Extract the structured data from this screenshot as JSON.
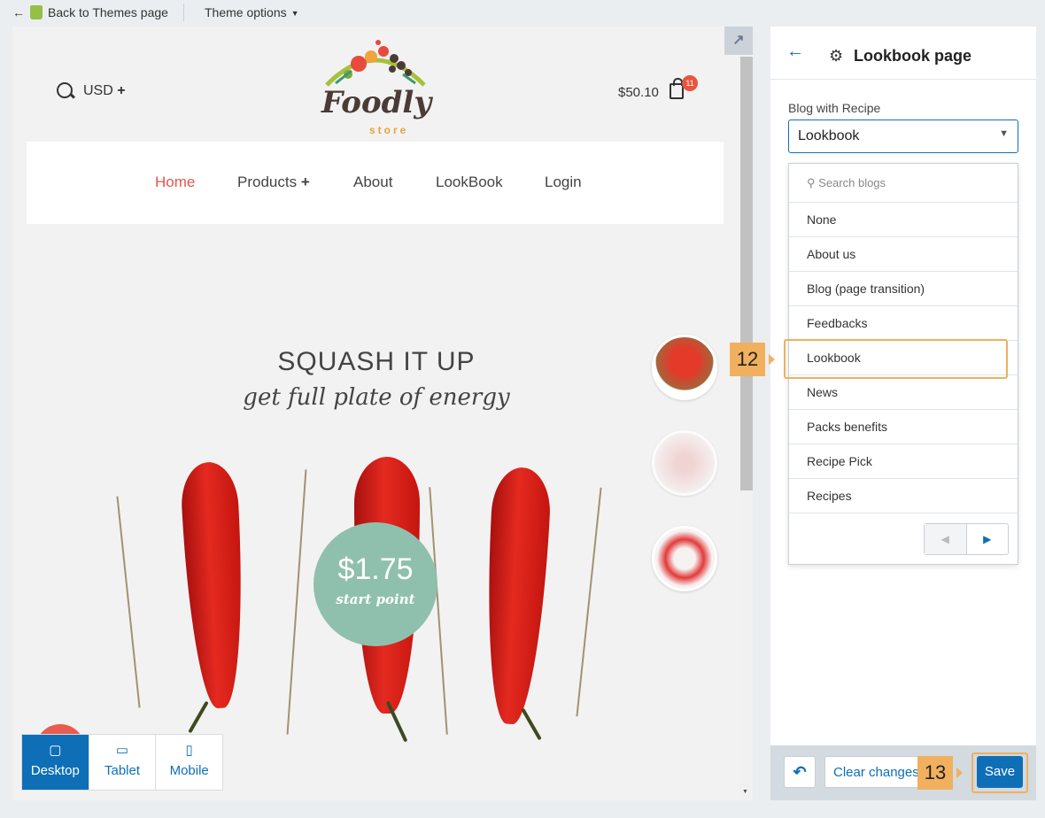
{
  "topbar": {
    "back_label": "Back to Themes page",
    "theme_options_label": "Theme options"
  },
  "store": {
    "currency": "USD",
    "logo_word": "Foodly",
    "logo_sub": "store",
    "cart_total": "$50.10",
    "cart_count": "11",
    "nav": [
      "Home",
      "Products",
      "About",
      "LookBook",
      "Login"
    ],
    "hero_title": "SQUASH IT UP",
    "hero_subtitle": "get full plate of energy",
    "price": "$1.75",
    "price_caption": "start point"
  },
  "view_toggle": [
    "Desktop",
    "Tablet",
    "Mobile"
  ],
  "panel": {
    "title": "Lookbook page",
    "field_label": "Blog with Recipe",
    "selected": "Lookbook",
    "search_placeholder": "Search blogs",
    "options": [
      "None",
      "About us",
      "Blog (page transition)",
      "Feedbacks",
      "Lookbook",
      "News",
      "Packs benefits",
      "Recipe Pick",
      "Recipes"
    ]
  },
  "callouts": {
    "step12": "12",
    "step13": "13"
  },
  "footer": {
    "clear_label": "Clear changes",
    "save_label": "Save"
  },
  "colors": {
    "accent": "#0e6fb7",
    "callout": "#f0b05d",
    "nav_active": "#e0574f",
    "price_circle": "#8fc0ae"
  }
}
